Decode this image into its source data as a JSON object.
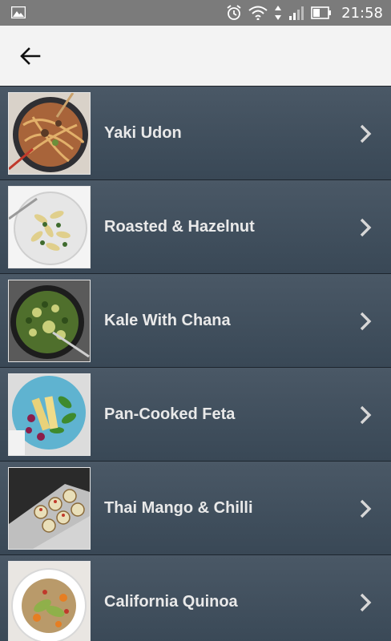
{
  "status_bar": {
    "time": "21:58",
    "icons": [
      "image-icon",
      "alarm-icon",
      "wifi-icon",
      "data-arrows-icon",
      "signal-icon",
      "battery-icon"
    ]
  },
  "app_bar": {
    "back_icon": "arrow-left-icon"
  },
  "recipes": [
    {
      "title": "Yaki Udon",
      "thumb": "noodles"
    },
    {
      "title": "Roasted & Hazelnut",
      "thumb": "pasta"
    },
    {
      "title": "Kale With Chana",
      "thumb": "skillet"
    },
    {
      "title": "Pan-Cooked Feta",
      "thumb": "salad"
    },
    {
      "title": "Thai Mango & Chilli",
      "thumb": "bites"
    },
    {
      "title": "California Quinoa",
      "thumb": "quinoa"
    }
  ],
  "colors": {
    "status_bar": "#7b7b7b",
    "app_bar": "#f3f3f3",
    "row_top": "#4a5866",
    "row_bottom": "#394856",
    "text": "#e9e9e9"
  }
}
